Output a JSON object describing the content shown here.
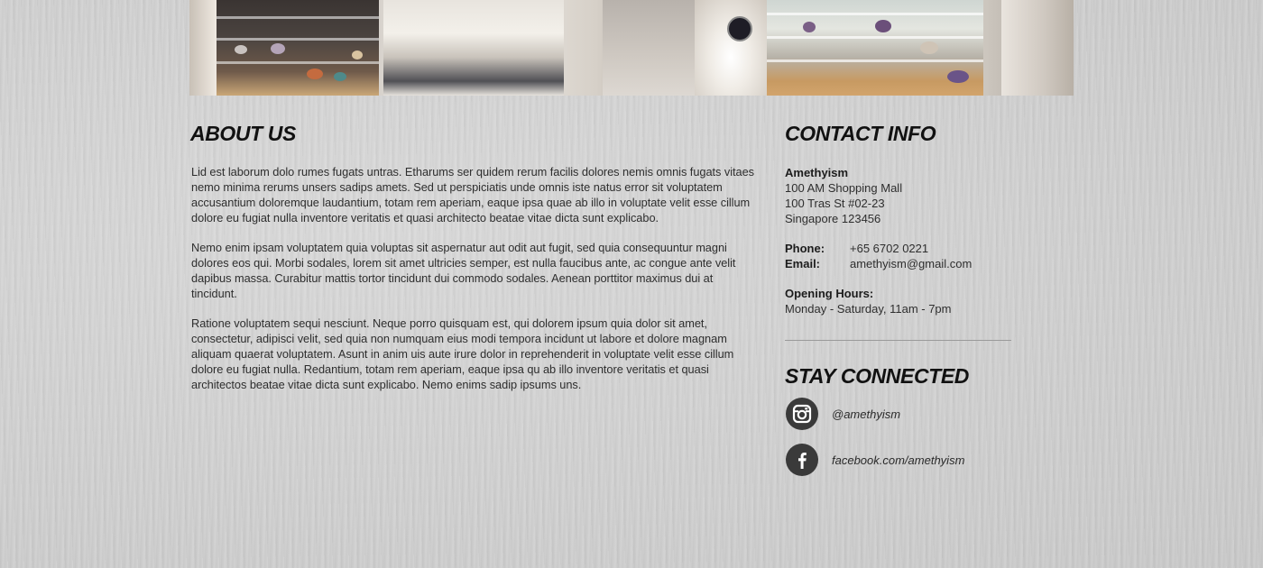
{
  "banner": {
    "alt_label": "store-interior-photo"
  },
  "about": {
    "heading": "ABOUT US",
    "paragraphs": [
      "Lid est laborum dolo rumes fugats untras. Etharums ser quidem rerum facilis dolores nemis omnis fugats vitaes nemo minima rerums unsers sadips amets. Sed ut perspiciatis unde omnis iste natus error sit voluptatem accusantium doloremque laudantium, totam rem aperiam, eaque ipsa quae ab illo in voluptate velit esse cillum dolore eu fugiat nulla inventore veritatis et quasi architecto beatae vitae dicta sunt explicabo.",
      "Nemo enim ipsam voluptatem quia voluptas sit aspernatur aut odit aut fugit, sed quia consequuntur magni dolores eos qui. Morbi sodales, lorem sit amet ultricies semper, est nulla faucibus ante, ac congue ante velit dapibus massa. Curabitur mattis tortor tincidunt dui commodo sodales. Aenean porttitor maximus dui at tincidunt.",
      "Ratione voluptatem sequi nesciunt. Neque porro quisquam est, qui dolorem ipsum quia dolor sit amet, consectetur, adipisci velit, sed quia non numquam eius modi tempora incidunt ut labore et dolore magnam aliquam quaerat voluptatem. Asunt in anim uis aute irure dolor in reprehenderit in voluptate velit esse cillum dolore eu fugiat nulla. Redantium, totam rem aperiam, eaque ipsa qu ab illo inventore veritatis et quasi architectos beatae vitae dicta sunt explicabo. Nemo enims sadip ipsums uns."
    ]
  },
  "contact": {
    "heading": "CONTACT INFO",
    "business_name": "Amethyism",
    "address_lines": [
      "100 AM Shopping Mall",
      "100 Tras St #02-23",
      "Singapore 123456"
    ],
    "phone_label": "Phone:",
    "phone": "+65 6702 0221",
    "email_label": "Email:",
    "email": "amethyism@gmail.com",
    "hours_label": "Opening Hours:",
    "hours": "Monday - Saturday, 11am - 7pm"
  },
  "social": {
    "heading": "STAY CONNECTED",
    "instagram": {
      "icon": "instagram-icon",
      "handle": "@amethyism"
    },
    "facebook": {
      "icon": "facebook-icon",
      "handle": "facebook.com/amethyism"
    }
  },
  "colors": {
    "heading": "#111111",
    "body_text": "#2e2e2e",
    "icon_bg": "#3a3a3a",
    "divider": "#9a9a9a",
    "page_bg": "#d0d0d0"
  }
}
